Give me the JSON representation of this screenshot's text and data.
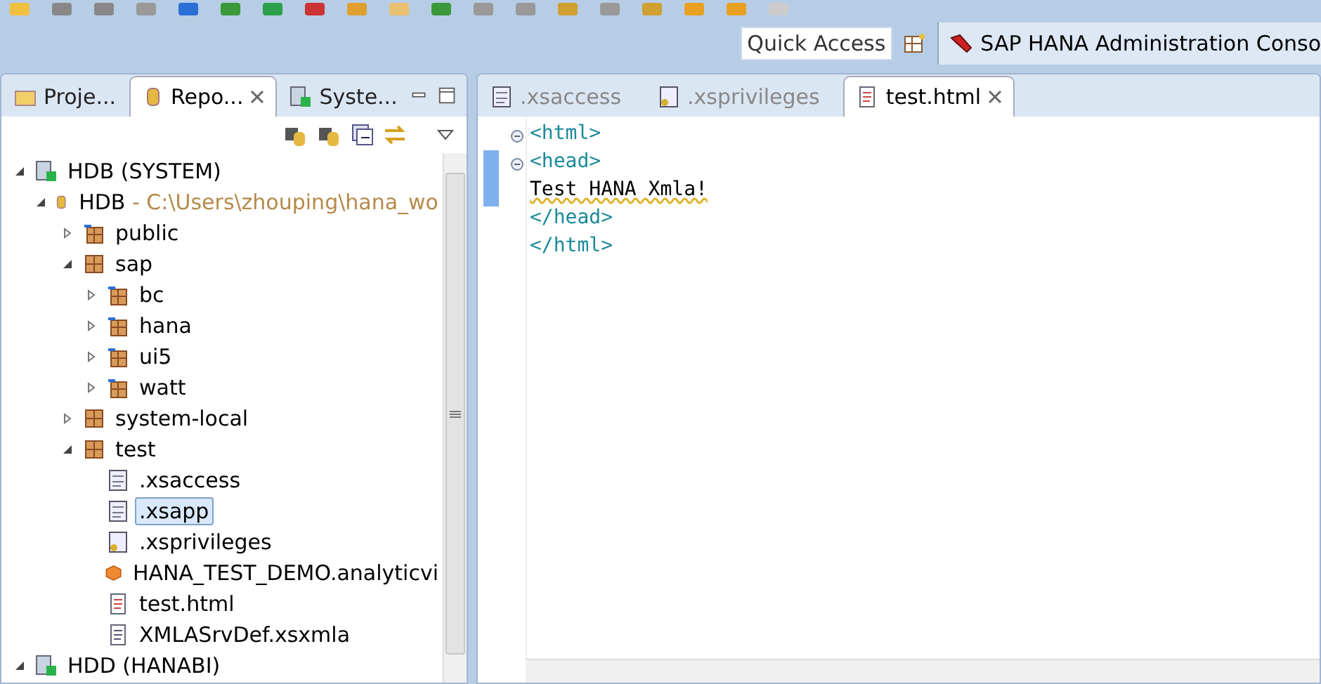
{
  "quick_access": {
    "placeholder": "Quick Access"
  },
  "perspective": {
    "label": "SAP HANA Administration Conso"
  },
  "left_tabs": [
    {
      "label": "Proje...",
      "kind": "project",
      "selected": false
    },
    {
      "label": "Repo...",
      "kind": "repo",
      "selected": true
    },
    {
      "label": "Syste...",
      "kind": "system",
      "selected": false
    }
  ],
  "tree": [
    {
      "label": "HDB (SYSTEM)",
      "kind": "system",
      "expanded": true,
      "selected": false,
      "children": [
        {
          "label": "HDB",
          "suffix": " - C:\\Users\\zhouping\\hana_wo",
          "kind": "repo",
          "expanded": true,
          "selected": false,
          "children": [
            {
              "label": "public",
              "kind": "linked-package",
              "expanded": false,
              "selected": false
            },
            {
              "label": "sap",
              "kind": "package",
              "expanded": true,
              "selected": false,
              "children": [
                {
                  "label": "bc",
                  "kind": "linked-package",
                  "expanded": false,
                  "selected": false
                },
                {
                  "label": "hana",
                  "kind": "linked-package",
                  "expanded": false,
                  "selected": false
                },
                {
                  "label": "ui5",
                  "kind": "linked-package",
                  "expanded": false,
                  "selected": false
                },
                {
                  "label": "watt",
                  "kind": "linked-package",
                  "expanded": false,
                  "selected": false
                }
              ]
            },
            {
              "label": "system-local",
              "kind": "package",
              "expanded": false,
              "selected": false
            },
            {
              "label": "test",
              "kind": "package",
              "expanded": true,
              "selected": false,
              "children": [
                {
                  "label": ".xsaccess",
                  "kind": "xsfile",
                  "selected": false
                },
                {
                  "label": ".xsapp",
                  "kind": "xsfile",
                  "selected": true
                },
                {
                  "label": ".xsprivileges",
                  "kind": "xskey",
                  "selected": false
                },
                {
                  "label": "HANA_TEST_DEMO.analyticvi",
                  "kind": "cube",
                  "selected": false
                },
                {
                  "label": "test.html",
                  "kind": "html",
                  "selected": false
                },
                {
                  "label": "XMLASrvDef.xsxmla",
                  "kind": "doc",
                  "selected": false
                }
              ]
            }
          ]
        }
      ]
    },
    {
      "label": "HDD (HANABI)",
      "kind": "system",
      "expanded": true,
      "selected": false
    }
  ],
  "editor_tabs": [
    {
      "label": ".xsaccess",
      "kind": "xsfile",
      "selected": false
    },
    {
      "label": ".xsprivileges",
      "kind": "xskey",
      "selected": false
    },
    {
      "label": "test.html",
      "kind": "html",
      "selected": true
    }
  ],
  "code_lines": [
    {
      "text": "<html>",
      "kind": "tag",
      "foldable": true,
      "changed": false
    },
    {
      "text": "<head>",
      "kind": "tag",
      "foldable": true,
      "changed": true
    },
    {
      "text": "Test HANA Xmla!",
      "kind": "text",
      "foldable": false,
      "changed": true
    },
    {
      "text": "</head>",
      "kind": "tag",
      "foldable": false,
      "changed": false
    },
    {
      "text": "</html>",
      "kind": "tag",
      "foldable": false,
      "changed": false
    }
  ]
}
